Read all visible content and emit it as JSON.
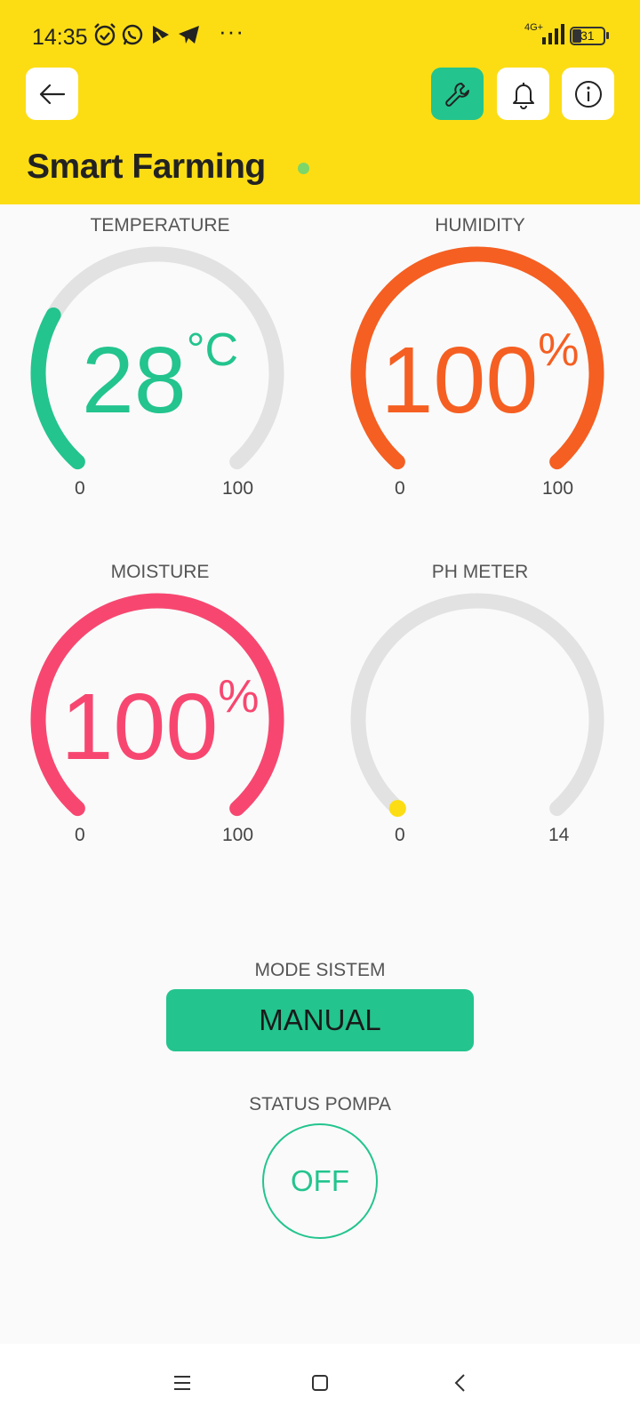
{
  "status_bar": {
    "time": "14:35",
    "network": "4G+",
    "battery": "31",
    "more": "···"
  },
  "header": {
    "title": "Smart Farming",
    "status_color": "#7cd66a",
    "background": "#fcdd14",
    "buttons": {
      "back": "back-arrow-icon",
      "settings": "wrench-icon",
      "notifications": "bell-icon",
      "info": "info-icon"
    }
  },
  "gauges": [
    {
      "id": "temperature",
      "title": "TEMPERATURE",
      "value": "28",
      "value_num": 28,
      "unit": "°C",
      "min": "0",
      "max": "100",
      "min_num": 0,
      "max_num": 100,
      "color": "#23c48e"
    },
    {
      "id": "humidity",
      "title": "HUMIDITY",
      "value": "100",
      "value_num": 100,
      "unit": "%",
      "min": "0",
      "max": "100",
      "min_num": 0,
      "max_num": 100,
      "color": "#f55f22"
    },
    {
      "id": "moisture",
      "title": "MOISTURE",
      "value": "100",
      "value_num": 100,
      "unit": "%",
      "min": "0",
      "max": "100",
      "min_num": 0,
      "max_num": 100,
      "color": "#f74770"
    },
    {
      "id": "ph",
      "title": "PH METER",
      "value": "",
      "value_num": 0,
      "unit": "",
      "min": "0",
      "max": "14",
      "min_num": 0,
      "max_num": 14,
      "color": "#fcdd14"
    }
  ],
  "mode": {
    "label": "MODE SISTEM",
    "value": "MANUAL",
    "color": "#23c48e"
  },
  "pump": {
    "label": "STATUS POMPA",
    "value": "OFF",
    "color": "#23c48e"
  },
  "track_color": "#e2e2e2"
}
